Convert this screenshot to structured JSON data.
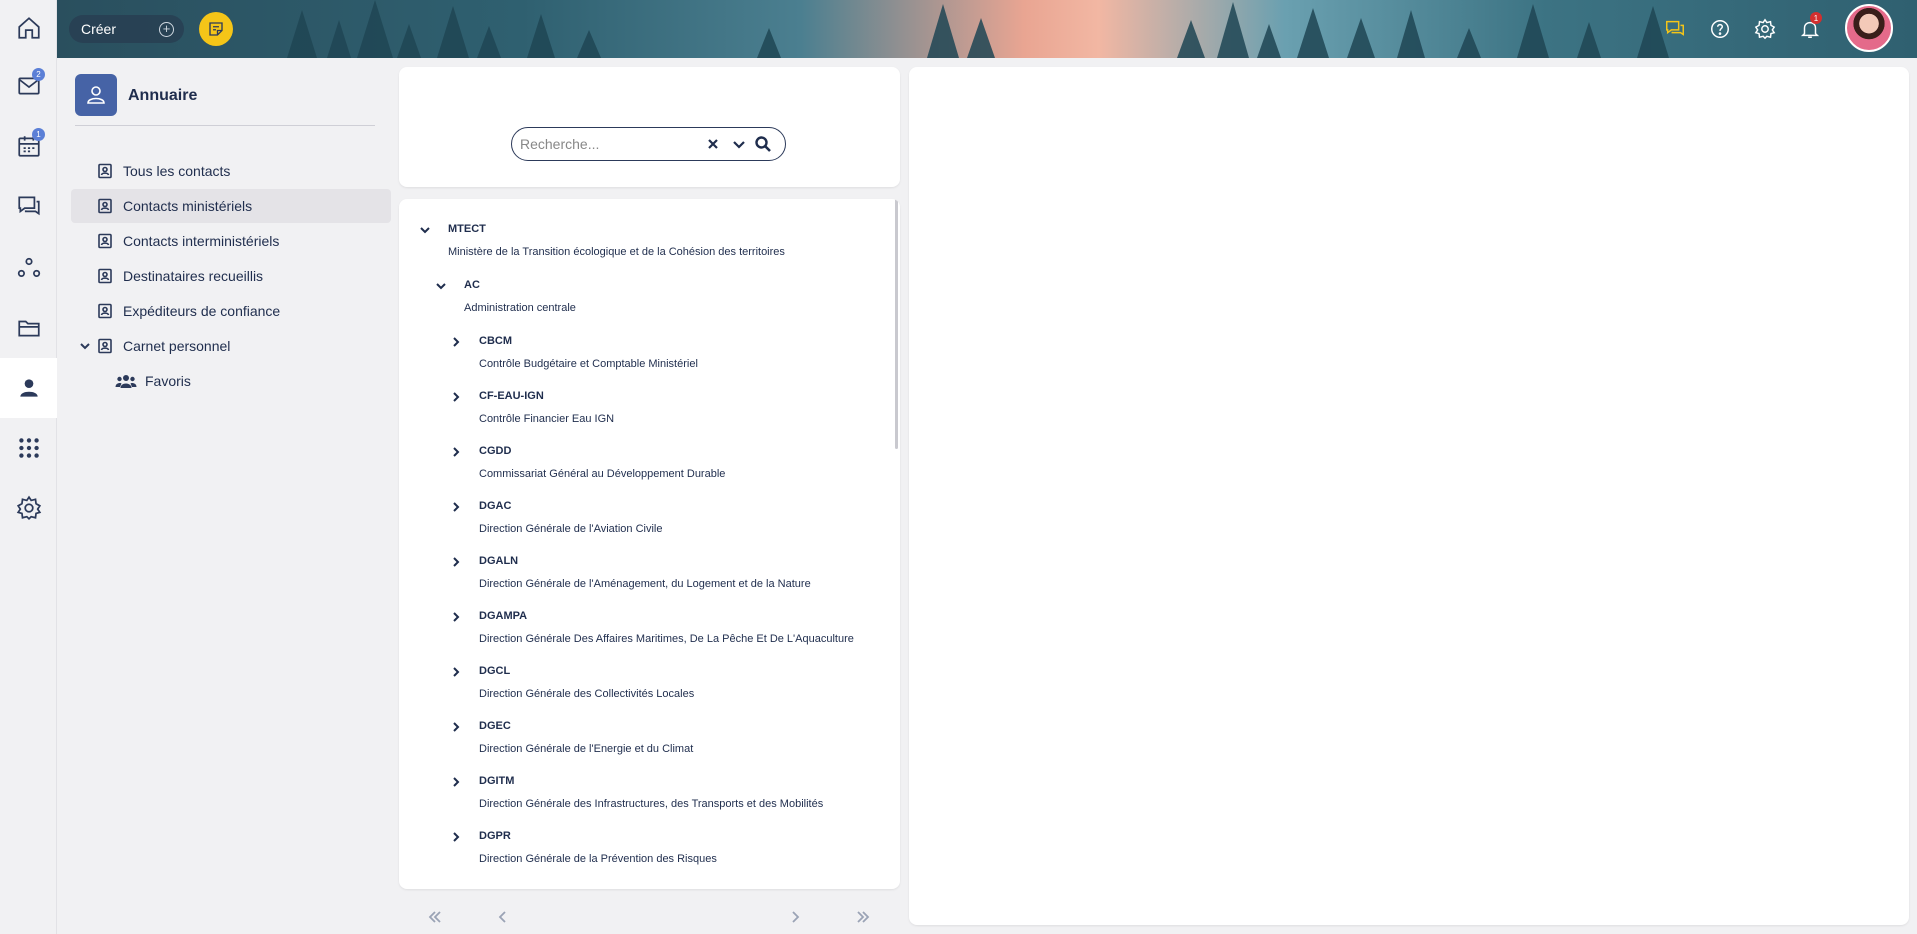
{
  "rail": {
    "items": [
      {
        "name": "home",
        "badge": ""
      },
      {
        "name": "mail",
        "badge": "2"
      },
      {
        "name": "calendar",
        "badge": "1"
      },
      {
        "name": "chat",
        "badge": ""
      },
      {
        "name": "workflow",
        "badge": ""
      },
      {
        "name": "folder",
        "badge": ""
      },
      {
        "name": "contacts",
        "badge": ""
      },
      {
        "name": "apps",
        "badge": ""
      },
      {
        "name": "settings",
        "badge": ""
      }
    ]
  },
  "topbar": {
    "create_label": "Créer",
    "notification_count": "1",
    "accent_color": "#f5c518"
  },
  "sidebar": {
    "title": "Annuaire",
    "items": [
      {
        "label": "Tous les contacts"
      },
      {
        "label": "Contacts ministériels"
      },
      {
        "label": "Contacts interministériels"
      },
      {
        "label": "Destinataires recueillis"
      },
      {
        "label": "Expéditeurs de confiance"
      },
      {
        "label": "Carnet personnel"
      },
      {
        "label": "Favoris"
      }
    ]
  },
  "search": {
    "placeholder": "Recherche..."
  },
  "tree": {
    "root": {
      "code": "MTECT",
      "desc": "Ministère de la Transition écologique et de la Cohésion des territoires"
    },
    "child": {
      "code": "AC",
      "desc": "Administration centrale"
    },
    "leaves": [
      {
        "code": "CBCM",
        "desc": "Contrôle Budgétaire et Comptable Ministériel"
      },
      {
        "code": "CF-EAU-IGN",
        "desc": "Contrôle Financier Eau IGN"
      },
      {
        "code": "CGDD",
        "desc": "Commissariat Général au Développement Durable"
      },
      {
        "code": "DGAC",
        "desc": "Direction Générale de l'Aviation Civile"
      },
      {
        "code": "DGALN",
        "desc": "Direction Générale de l'Aménagement, du Logement et de la Nature"
      },
      {
        "code": "DGAMPA",
        "desc": "Direction Générale Des Affaires Maritimes, De La Pêche Et De L'Aquaculture"
      },
      {
        "code": "DGCL",
        "desc": "Direction Générale des Collectivités Locales"
      },
      {
        "code": "DGEC",
        "desc": "Direction Générale de l'Energie et du Climat"
      },
      {
        "code": "DGITM",
        "desc": "Direction Générale des Infrastructures, des Transports et des Mobilités"
      },
      {
        "code": "DGPR",
        "desc": "Direction Générale de la Prévention des Risques"
      }
    ]
  }
}
